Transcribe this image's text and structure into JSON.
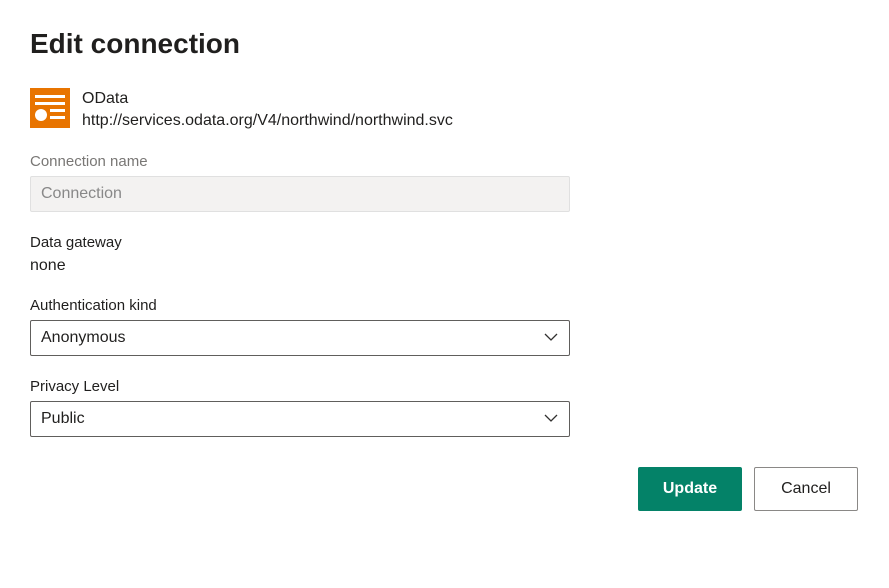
{
  "title": "Edit connection",
  "datasource": {
    "icon": "odata-icon",
    "name": "OData",
    "url": "http://services.odata.org/V4/northwind/northwind.svc"
  },
  "fields": {
    "connectionName": {
      "label": "Connection name",
      "placeholder": "Connection",
      "value": ""
    },
    "dataGateway": {
      "label": "Data gateway",
      "value": "none"
    },
    "authKind": {
      "label": "Authentication kind",
      "selected": "Anonymous"
    },
    "privacyLevel": {
      "label": "Privacy Level",
      "selected": "Public"
    }
  },
  "buttons": {
    "update": "Update",
    "cancel": "Cancel"
  }
}
